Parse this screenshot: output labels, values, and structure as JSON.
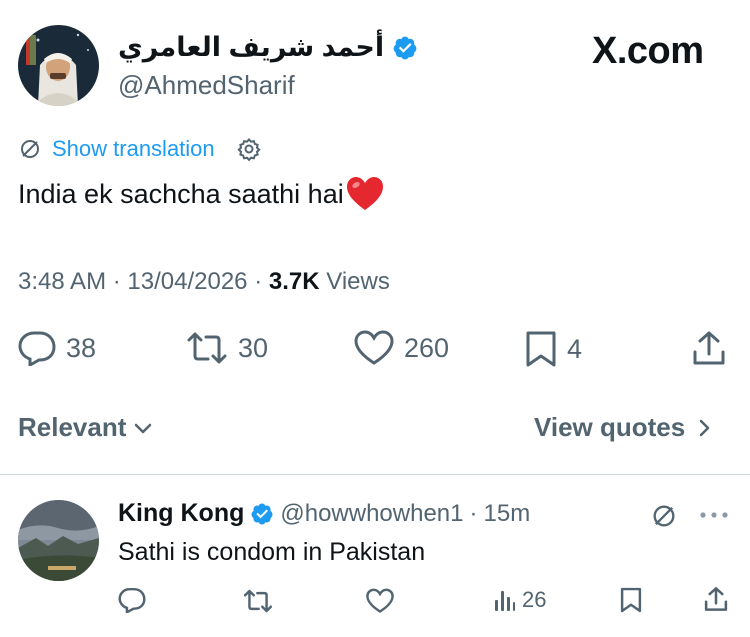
{
  "tweet": {
    "author_name": "أحمد شريف العامري",
    "handle": "@AhmedSharif",
    "brand": "X.com",
    "translation_label": "Show translation",
    "text": "India ek sachcha saathi hai",
    "emoji": "❤️",
    "time": "3:48 AM",
    "date": "13/04/2026",
    "views_count": "3.7K",
    "views_label": "Views",
    "replies": "38",
    "reposts": "30",
    "likes": "260",
    "bookmarks": "4"
  },
  "filter": {
    "sort_label": "Relevant",
    "quotes_label": "View quotes"
  },
  "reply": {
    "author_name": "King Kong",
    "handle": "@howwhowhen1",
    "time": "15m",
    "text": "Sathi is condom in Pakistan",
    "views": "26"
  },
  "colors": {
    "verified": "#1d9bf0",
    "link": "#1d9bf0",
    "muted": "#536471",
    "heart": "#e0245e"
  },
  "icons": [
    "verified-badge-icon",
    "translate-icon",
    "gear-icon",
    "reply-icon",
    "repost-icon",
    "like-icon",
    "bookmark-icon",
    "share-icon",
    "chevron-down-icon",
    "chevron-right-icon",
    "views-icon",
    "more-icon",
    "heart-emoji-icon"
  ]
}
